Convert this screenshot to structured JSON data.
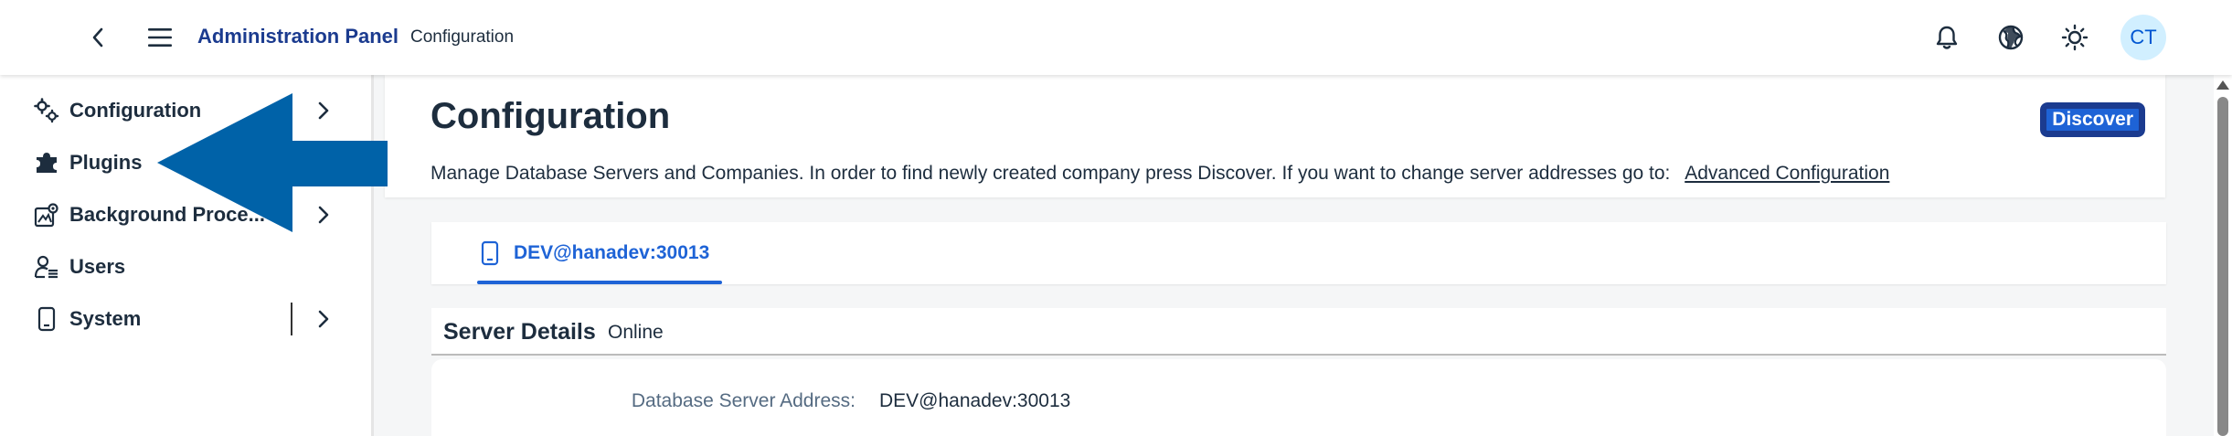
{
  "shell": {
    "title": "Administration Panel",
    "subtitle": "Configuration",
    "avatar_initials": "CT",
    "icons": [
      "back-icon",
      "menu-icon",
      "bell-icon",
      "globe-icon",
      "sun-icon"
    ]
  },
  "sidebar": {
    "items": [
      {
        "label": "Configuration",
        "icon": "gears-icon",
        "has_chevron": true
      },
      {
        "label": "Plugins",
        "icon": "puzzle-icon",
        "has_chevron": false
      },
      {
        "label": "Background Proce...",
        "icon": "background-process-icon",
        "has_chevron": true
      },
      {
        "label": "Users",
        "icon": "user-list-icon",
        "has_chevron": false
      },
      {
        "label": "System",
        "icon": "device-icon",
        "has_chevron": true
      }
    ]
  },
  "main": {
    "title": "Configuration",
    "discover_label": "Discover",
    "description": "Manage Database Servers and Companies. In order to find newly created company press Discover. If you want to change server addresses go to:",
    "advanced_link": "Advanced Configuration",
    "tabs": [
      {
        "label": "DEV@hanadev:30013",
        "selected": true
      }
    ],
    "section": {
      "title": "Server Details",
      "status": "Online"
    },
    "fields": [
      {
        "label": "Database Server Address:",
        "value": "DEV@hanadev:30013"
      }
    ]
  },
  "colors": {
    "accent": "#1e63d6",
    "brand": "#1b3b8f",
    "arrow": "#0062a8",
    "avatar_bg": "#d1efff"
  }
}
